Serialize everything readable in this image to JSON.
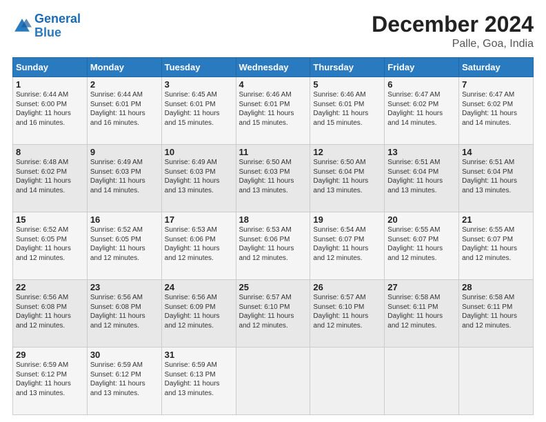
{
  "header": {
    "logo_line1": "General",
    "logo_line2": "Blue",
    "title": "December 2024",
    "subtitle": "Palle, Goa, India"
  },
  "days_of_week": [
    "Sunday",
    "Monday",
    "Tuesday",
    "Wednesday",
    "Thursday",
    "Friday",
    "Saturday"
  ],
  "weeks": [
    [
      {
        "day": "1",
        "info": "Sunrise: 6:44 AM\nSunset: 6:00 PM\nDaylight: 11 hours\nand 16 minutes."
      },
      {
        "day": "2",
        "info": "Sunrise: 6:44 AM\nSunset: 6:01 PM\nDaylight: 11 hours\nand 16 minutes."
      },
      {
        "day": "3",
        "info": "Sunrise: 6:45 AM\nSunset: 6:01 PM\nDaylight: 11 hours\nand 15 minutes."
      },
      {
        "day": "4",
        "info": "Sunrise: 6:46 AM\nSunset: 6:01 PM\nDaylight: 11 hours\nand 15 minutes."
      },
      {
        "day": "5",
        "info": "Sunrise: 6:46 AM\nSunset: 6:01 PM\nDaylight: 11 hours\nand 15 minutes."
      },
      {
        "day": "6",
        "info": "Sunrise: 6:47 AM\nSunset: 6:02 PM\nDaylight: 11 hours\nand 14 minutes."
      },
      {
        "day": "7",
        "info": "Sunrise: 6:47 AM\nSunset: 6:02 PM\nDaylight: 11 hours\nand 14 minutes."
      }
    ],
    [
      {
        "day": "8",
        "info": "Sunrise: 6:48 AM\nSunset: 6:02 PM\nDaylight: 11 hours\nand 14 minutes."
      },
      {
        "day": "9",
        "info": "Sunrise: 6:49 AM\nSunset: 6:03 PM\nDaylight: 11 hours\nand 14 minutes."
      },
      {
        "day": "10",
        "info": "Sunrise: 6:49 AM\nSunset: 6:03 PM\nDaylight: 11 hours\nand 13 minutes."
      },
      {
        "day": "11",
        "info": "Sunrise: 6:50 AM\nSunset: 6:03 PM\nDaylight: 11 hours\nand 13 minutes."
      },
      {
        "day": "12",
        "info": "Sunrise: 6:50 AM\nSunset: 6:04 PM\nDaylight: 11 hours\nand 13 minutes."
      },
      {
        "day": "13",
        "info": "Sunrise: 6:51 AM\nSunset: 6:04 PM\nDaylight: 11 hours\nand 13 minutes."
      },
      {
        "day": "14",
        "info": "Sunrise: 6:51 AM\nSunset: 6:04 PM\nDaylight: 11 hours\nand 13 minutes."
      }
    ],
    [
      {
        "day": "15",
        "info": "Sunrise: 6:52 AM\nSunset: 6:05 PM\nDaylight: 11 hours\nand 12 minutes."
      },
      {
        "day": "16",
        "info": "Sunrise: 6:52 AM\nSunset: 6:05 PM\nDaylight: 11 hours\nand 12 minutes."
      },
      {
        "day": "17",
        "info": "Sunrise: 6:53 AM\nSunset: 6:06 PM\nDaylight: 11 hours\nand 12 minutes."
      },
      {
        "day": "18",
        "info": "Sunrise: 6:53 AM\nSunset: 6:06 PM\nDaylight: 11 hours\nand 12 minutes."
      },
      {
        "day": "19",
        "info": "Sunrise: 6:54 AM\nSunset: 6:07 PM\nDaylight: 11 hours\nand 12 minutes."
      },
      {
        "day": "20",
        "info": "Sunrise: 6:55 AM\nSunset: 6:07 PM\nDaylight: 11 hours\nand 12 minutes."
      },
      {
        "day": "21",
        "info": "Sunrise: 6:55 AM\nSunset: 6:07 PM\nDaylight: 11 hours\nand 12 minutes."
      }
    ],
    [
      {
        "day": "22",
        "info": "Sunrise: 6:56 AM\nSunset: 6:08 PM\nDaylight: 11 hours\nand 12 minutes."
      },
      {
        "day": "23",
        "info": "Sunrise: 6:56 AM\nSunset: 6:08 PM\nDaylight: 11 hours\nand 12 minutes."
      },
      {
        "day": "24",
        "info": "Sunrise: 6:56 AM\nSunset: 6:09 PM\nDaylight: 11 hours\nand 12 minutes."
      },
      {
        "day": "25",
        "info": "Sunrise: 6:57 AM\nSunset: 6:10 PM\nDaylight: 11 hours\nand 12 minutes."
      },
      {
        "day": "26",
        "info": "Sunrise: 6:57 AM\nSunset: 6:10 PM\nDaylight: 11 hours\nand 12 minutes."
      },
      {
        "day": "27",
        "info": "Sunrise: 6:58 AM\nSunset: 6:11 PM\nDaylight: 11 hours\nand 12 minutes."
      },
      {
        "day": "28",
        "info": "Sunrise: 6:58 AM\nSunset: 6:11 PM\nDaylight: 11 hours\nand 12 minutes."
      }
    ],
    [
      {
        "day": "29",
        "info": "Sunrise: 6:59 AM\nSunset: 6:12 PM\nDaylight: 11 hours\nand 13 minutes."
      },
      {
        "day": "30",
        "info": "Sunrise: 6:59 AM\nSunset: 6:12 PM\nDaylight: 11 hours\nand 13 minutes."
      },
      {
        "day": "31",
        "info": "Sunrise: 6:59 AM\nSunset: 6:13 PM\nDaylight: 11 hours\nand 13 minutes."
      },
      null,
      null,
      null,
      null
    ]
  ]
}
